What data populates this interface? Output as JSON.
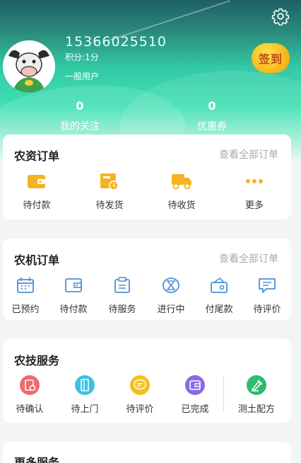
{
  "header": {
    "phone": "15366025510",
    "points": "积分:1分",
    "role": "一般用户",
    "sign_in": "签到",
    "stats": [
      {
        "value": "0",
        "label": "我的关注"
      },
      {
        "value": "0",
        "label": "优惠券"
      }
    ]
  },
  "supplies_orders": {
    "title": "农资订单",
    "view_all": "查看全部订单",
    "items": [
      {
        "label": "待付款",
        "icon": "wallet-icon"
      },
      {
        "label": "待发货",
        "icon": "shipping-box-icon"
      },
      {
        "label": "待收货",
        "icon": "truck-icon"
      },
      {
        "label": "更多",
        "icon": "more-dots-icon"
      }
    ]
  },
  "machinery_orders": {
    "title": "农机订单",
    "view_all": "查看全部订单",
    "items": [
      {
        "label": "已预约",
        "icon": "calendar-icon"
      },
      {
        "label": "待付款",
        "icon": "wallet-icon"
      },
      {
        "label": "待服务",
        "icon": "clipboard-icon"
      },
      {
        "label": "进行中",
        "icon": "hourglass-icon"
      },
      {
        "label": "付尾款",
        "icon": "purse-icon"
      },
      {
        "label": "待评价",
        "icon": "comment-icon"
      }
    ]
  },
  "tech_services": {
    "title": "农技服务",
    "items": [
      {
        "label": "待确认",
        "icon": "confirm-icon"
      },
      {
        "label": "待上门",
        "icon": "door-icon"
      },
      {
        "label": "待评价",
        "icon": "comment-icon"
      },
      {
        "label": "已完成",
        "icon": "wallet-icon"
      },
      {
        "label": "测土配方",
        "icon": "soil-test-icon"
      }
    ]
  },
  "more_services": {
    "title": "更多服务"
  },
  "colors": {
    "accent_green": "#3ee0b3",
    "supplies_icon": "#f5b324",
    "machinery_icon": "#4d8fd6",
    "tech_red": "#ef6a6a",
    "tech_cyan": "#3cc1e3",
    "tech_yellow": "#f4c01e",
    "tech_purple": "#8a6ae6",
    "tech_green": "#2dbd6e"
  }
}
